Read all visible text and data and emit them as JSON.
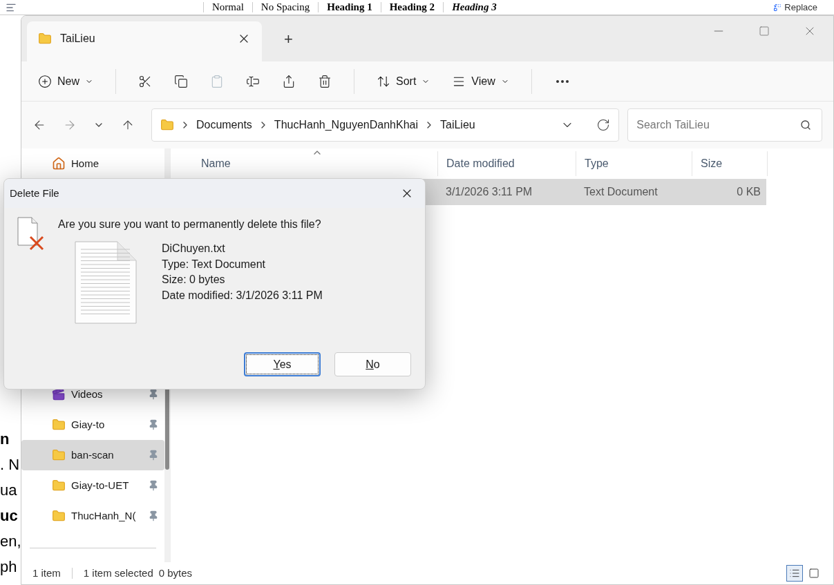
{
  "background_document": {
    "ribbon_styles": [
      {
        "label": "Normal",
        "kind": "plain"
      },
      {
        "label": "No Spacing",
        "kind": "plain"
      },
      {
        "label": "Heading 1",
        "kind": "heading"
      },
      {
        "label": "Heading 2",
        "kind": "heading"
      },
      {
        "label": "Heading 3",
        "kind": "italic"
      }
    ],
    "replace_label": "Replace",
    "text_fragments": [
      {
        "text": "n",
        "bold": true
      },
      {
        "text": ". N",
        "bold": false
      },
      {
        "text": "ua",
        "bold": false
      },
      {
        "text": "uc",
        "bold": true
      },
      {
        "text": "en,",
        "bold": false
      },
      {
        "text": "ph",
        "bold": false
      }
    ]
  },
  "explorer": {
    "tabs": [
      {
        "label": "TaiLieu",
        "selected": true
      }
    ],
    "new_tab_label": "+",
    "toolbar": {
      "new_label": "New",
      "actions": [
        {
          "kind": "cut",
          "disabled": false
        },
        {
          "kind": "copy",
          "disabled": false
        },
        {
          "kind": "paste",
          "disabled": true
        },
        {
          "kind": "rename",
          "disabled": false
        },
        {
          "kind": "share",
          "disabled": false
        },
        {
          "kind": "delete",
          "disabled": false
        }
      ],
      "sort_label": "Sort",
      "view_label": "View"
    },
    "breadcrumb": [
      "Documents",
      "ThucHanh_NguyenDanhKhai",
      "TaiLieu"
    ],
    "search": {
      "placeholder": "Search TaiLieu"
    },
    "sidebar_top": [
      {
        "label": "Home",
        "kind": "home",
        "selected": false
      }
    ],
    "sidebar_quick": [
      {
        "label": "Videos",
        "kind": "videos",
        "pinned": true,
        "selected": false
      },
      {
        "label": "Giay-to",
        "kind": "folder",
        "pinned": true,
        "selected": false
      },
      {
        "label": "ban-scan",
        "kind": "folder",
        "pinned": true,
        "selected": true
      },
      {
        "label": "Giay-to-UET",
        "kind": "folder",
        "pinned": true,
        "selected": false
      },
      {
        "label": "ThucHanh_N(",
        "kind": "folder",
        "pinned": true,
        "selected": false
      }
    ],
    "columns": [
      "Name",
      "Date modified",
      "Type",
      "Size"
    ],
    "rows": [
      {
        "date": "3/1/2026 3:11 PM",
        "type": "Text Document",
        "size": "0 KB",
        "selected": true
      }
    ],
    "status": {
      "count": "1 item",
      "selection": "1 item selected",
      "size": "0 bytes"
    },
    "views": [
      {
        "kind": "details",
        "selected": true
      },
      {
        "kind": "tiles",
        "selected": false
      }
    ]
  },
  "dialog": {
    "title": "Delete File",
    "message": "Are you sure you want to permanently delete this file?",
    "file_details": [
      "DiChuyen.txt",
      "Type: Text Document",
      "Size: 0 bytes",
      "Date modified: 3/1/2026 3:11 PM"
    ],
    "buttons": [
      {
        "label": "Yes",
        "focused": true
      },
      {
        "label": "No",
        "focused": false
      }
    ]
  }
}
